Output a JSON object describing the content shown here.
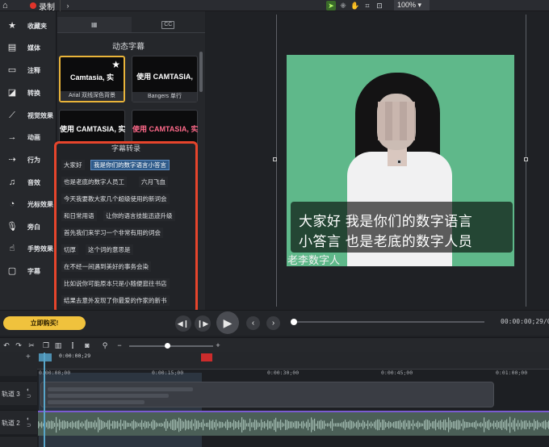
{
  "topbar": {
    "record_label": "录制",
    "zoom": "100%"
  },
  "sidebar": {
    "items": [
      {
        "label": "收藏夹",
        "icon": "star-icon"
      },
      {
        "label": "媒体",
        "icon": "film-icon"
      },
      {
        "label": "注释",
        "icon": "annotation-icon"
      },
      {
        "label": "转换",
        "icon": "transition-icon"
      },
      {
        "label": "视觉效果",
        "icon": "wand-icon"
      },
      {
        "label": "动画",
        "icon": "animation-icon"
      },
      {
        "label": "行为",
        "icon": "behavior-icon"
      },
      {
        "label": "音效",
        "icon": "audio-icon"
      },
      {
        "label": "光标效果",
        "icon": "cursor-icon"
      },
      {
        "label": "旁白",
        "icon": "microphone-icon"
      },
      {
        "label": "手势效果",
        "icon": "gesture-icon"
      },
      {
        "label": "字幕",
        "icon": "caption-icon"
      }
    ]
  },
  "panel": {
    "tab_right": "CC",
    "title": "动态字幕",
    "thumbs": [
      {
        "text": "Camtasia, 实",
        "caption": "Arial 双线深色背景"
      },
      {
        "text": "使用 CAMTASIA,",
        "caption": "Bangers 单行"
      },
      {
        "text": "使用 CAMTASIA, 实",
        "caption": ""
      },
      {
        "text": "使用 CAMTASIA, 实",
        "caption": ""
      }
    ]
  },
  "subtitles": {
    "title": "字幕转录",
    "items": [
      "大家好",
      "我是你们的数字语言小答言",
      "也是老底的数字人员工",
      "六月飞血",
      "今天我要教大家几个超级使用的新词会",
      "和日常用语",
      "让你的语言技能迅迹升级",
      "首先我们来学习一个非常有用的词会",
      "切厚",
      "这个词的意思是",
      "在不经一间遇到美好的事务会染",
      "比如说你可能原本只是小随便逛往书店",
      "结果去意外发现了你最爱的作家的新书"
    ]
  },
  "preview": {
    "caption_line1": "大家好 我是你们的数字语言",
    "caption_line2": "小答言 也是老底的数字人员",
    "overlay_text": "老李数字人"
  },
  "controls": {
    "buy_label": "立即购买!",
    "timecode": "00:00:00;29/0"
  },
  "timeline": {
    "playhead_time": "0:00:00;29",
    "ruler_ticks": [
      "0:00:00;00",
      "0:00:15;00",
      "0:00:30;00",
      "0:00:45;00",
      "0:01:00;00"
    ],
    "tracks": [
      "轨道 3",
      "轨道 2"
    ],
    "playhead_fraction": 0.0085
  },
  "colors": {
    "highlight_border": "#e6452c",
    "accent": "#f0c23d",
    "video_bg": "#5fb88a"
  }
}
